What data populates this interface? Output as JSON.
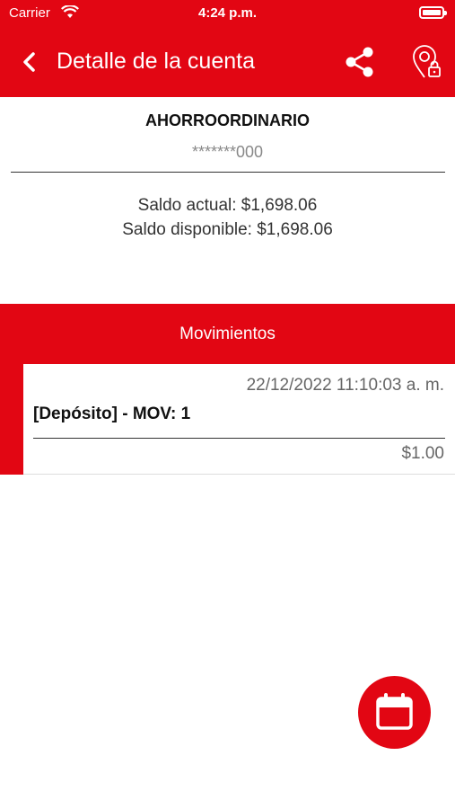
{
  "status_bar": {
    "carrier": "Carrier",
    "time": "4:24 p.m."
  },
  "header": {
    "title": "Detalle de la cuenta"
  },
  "account": {
    "name": "AHORROORDINARIO",
    "number": "*******000",
    "saldo_actual": "Saldo actual: $1,698.06",
    "saldo_disponible": "Saldo disponible: $1,698.06"
  },
  "movements": {
    "section_title": "Movimientos",
    "items": [
      {
        "date": "22/12/2022 11:10:03 a. m.",
        "description": "[Depósito] - MOV: 1",
        "amount": "$1.00"
      }
    ]
  },
  "colors": {
    "brand": "#e20613"
  },
  "icons": {
    "back": "chevron-left",
    "share": "share-icon",
    "location": "location-lock-icon",
    "calendar": "calendar-icon"
  }
}
